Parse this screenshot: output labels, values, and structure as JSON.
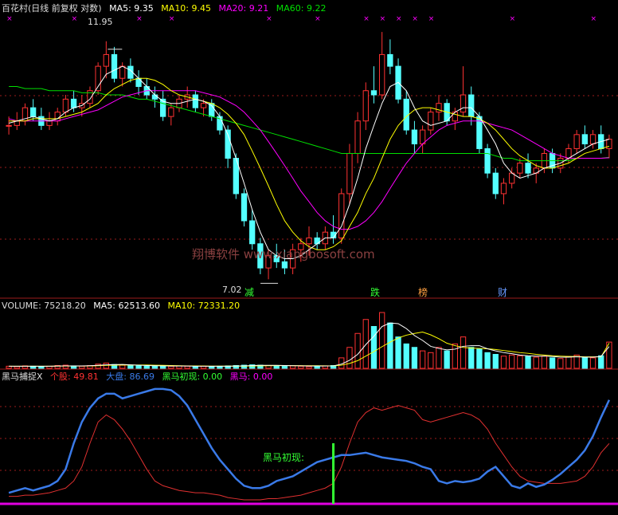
{
  "header_price": {
    "title": "百花村(日线 前复权 对数)",
    "ma5": "MA5: 9.35",
    "ma10": "MA10: 9.45",
    "ma20": "MA20: 9.21",
    "ma60": "MA60: 9.22"
  },
  "header_volume": {
    "title": "VOLUME: 75218.20",
    "ma5": "MA5: 62513.60",
    "ma10": "MA10: 72331.20"
  },
  "header_indicator": {
    "title": "黑马捕捉X",
    "stock": "个股: 49.81",
    "market": "大盘: 86.69",
    "first": "黑马初现: 0.00",
    "horse": "黑马: 0.00"
  },
  "annotations": {
    "high_label": "11.95",
    "low_label": "7.02",
    "watermark": "翔博软件 www.xiangbosoft.com",
    "signal_label": "黑马初现:",
    "tag_reduce": "减",
    "tag_fall": "跌",
    "tag_rank": "榜",
    "tag_finance": "财"
  },
  "colors": {
    "up": "#ff3232",
    "down": "#54ffff",
    "ma5": "#ffffff",
    "ma10": "#ffff00",
    "ma20": "#ff00ff",
    "ma60": "#00e000",
    "stock_line": "#e03030",
    "market_line": "#3a7ae8",
    "signal": "#33ff33",
    "grid": "#9b1b1b"
  },
  "chart_data": [
    {
      "type": "candlestick",
      "title": "百花村(日线 前复权 对数)",
      "price_range": [
        6.9,
        12.6
      ],
      "annotated_high": 11.95,
      "annotated_low": 7.02,
      "ohlc": [
        [
          9.9,
          10.1,
          9.7,
          9.9
        ],
        [
          9.9,
          10.2,
          9.8,
          10.0
        ],
        [
          10.0,
          10.4,
          9.9,
          10.3
        ],
        [
          10.3,
          10.5,
          10.0,
          10.1
        ],
        [
          10.1,
          10.3,
          9.8,
          9.9
        ],
        [
          9.9,
          10.2,
          9.8,
          10.0
        ],
        [
          10.0,
          10.3,
          9.9,
          10.2
        ],
        [
          10.2,
          10.6,
          10.1,
          10.5
        ],
        [
          10.5,
          10.7,
          10.2,
          10.3
        ],
        [
          10.3,
          10.6,
          10.1,
          10.4
        ],
        [
          10.4,
          10.8,
          10.3,
          10.7
        ],
        [
          10.7,
          11.4,
          10.6,
          11.3
        ],
        [
          11.3,
          11.95,
          11.0,
          11.6
        ],
        [
          11.6,
          11.8,
          10.9,
          11.0
        ],
        [
          11.0,
          11.4,
          10.8,
          11.3
        ],
        [
          11.3,
          11.5,
          10.9,
          11.0
        ],
        [
          11.0,
          11.2,
          10.6,
          10.8
        ],
        [
          10.8,
          11.0,
          10.5,
          10.6
        ],
        [
          10.6,
          10.8,
          10.3,
          10.5
        ],
        [
          10.5,
          10.7,
          10.0,
          10.1
        ],
        [
          10.1,
          10.4,
          9.9,
          10.3
        ],
        [
          10.3,
          10.6,
          10.2,
          10.5
        ],
        [
          10.5,
          10.8,
          10.3,
          10.6
        ],
        [
          10.6,
          10.7,
          10.2,
          10.3
        ],
        [
          10.3,
          10.5,
          10.1,
          10.4
        ],
        [
          10.4,
          10.5,
          10.0,
          10.1
        ],
        [
          10.1,
          10.2,
          9.7,
          9.8
        ],
        [
          9.8,
          9.9,
          9.0,
          9.2
        ],
        [
          9.2,
          9.3,
          8.4,
          8.5
        ],
        [
          8.5,
          8.6,
          7.9,
          8.0
        ],
        [
          8.0,
          8.2,
          7.5,
          7.6
        ],
        [
          7.6,
          7.7,
          7.1,
          7.2
        ],
        [
          7.2,
          7.5,
          7.02,
          7.4
        ],
        [
          7.4,
          7.6,
          7.2,
          7.3
        ],
        [
          7.3,
          7.5,
          7.1,
          7.2
        ],
        [
          7.2,
          7.6,
          7.1,
          7.5
        ],
        [
          7.5,
          7.7,
          7.3,
          7.6
        ],
        [
          7.6,
          7.9,
          7.4,
          7.7
        ],
        [
          7.7,
          7.8,
          7.5,
          7.6
        ],
        [
          7.6,
          7.9,
          7.5,
          7.8
        ],
        [
          7.8,
          8.1,
          7.6,
          7.7
        ],
        [
          7.7,
          8.6,
          7.6,
          8.5
        ],
        [
          8.5,
          9.5,
          8.3,
          9.3
        ],
        [
          9.3,
          10.2,
          9.1,
          10.0
        ],
        [
          10.0,
          10.9,
          9.8,
          10.7
        ],
        [
          10.7,
          11.3,
          10.4,
          10.6
        ],
        [
          10.6,
          12.2,
          10.5,
          11.6
        ],
        [
          11.6,
          12.0,
          11.1,
          11.3
        ],
        [
          11.3,
          11.5,
          10.4,
          10.5
        ],
        [
          10.5,
          10.7,
          9.7,
          9.8
        ],
        [
          9.8,
          10.0,
          9.3,
          9.5
        ],
        [
          9.5,
          9.9,
          9.3,
          9.8
        ],
        [
          9.8,
          10.3,
          9.7,
          10.2
        ],
        [
          10.2,
          10.6,
          10.0,
          10.4
        ],
        [
          10.4,
          10.5,
          9.9,
          10.0
        ],
        [
          10.0,
          10.3,
          9.8,
          10.2
        ],
        [
          10.2,
          11.3,
          10.1,
          10.6
        ],
        [
          10.6,
          10.8,
          9.9,
          10.1
        ],
        [
          10.1,
          10.2,
          9.3,
          9.4
        ],
        [
          9.4,
          9.5,
          8.8,
          8.9
        ],
        [
          8.9,
          9.0,
          8.4,
          8.5
        ],
        [
          8.5,
          8.8,
          8.3,
          8.7
        ],
        [
          8.7,
          9.0,
          8.6,
          8.9
        ],
        [
          8.9,
          9.2,
          8.8,
          9.1
        ],
        [
          9.1,
          9.3,
          8.8,
          8.9
        ],
        [
          8.9,
          9.1,
          8.7,
          9.0
        ],
        [
          9.0,
          9.4,
          8.9,
          9.3
        ],
        [
          9.3,
          9.4,
          8.9,
          9.0
        ],
        [
          9.0,
          9.3,
          8.9,
          9.2
        ],
        [
          9.2,
          9.5,
          9.1,
          9.4
        ],
        [
          9.4,
          9.8,
          9.3,
          9.7
        ],
        [
          9.7,
          9.9,
          9.4,
          9.5
        ],
        [
          9.5,
          9.8,
          9.4,
          9.7
        ],
        [
          9.7,
          9.9,
          9.3,
          9.4
        ],
        [
          9.4,
          9.7,
          9.2,
          9.6
        ]
      ],
      "ma5": [
        9.95,
        10.0,
        10.05,
        10.1,
        10.05,
        10.0,
        10.05,
        10.2,
        10.3,
        10.35,
        10.5,
        10.8,
        11.1,
        11.2,
        11.3,
        11.2,
        11.0,
        10.8,
        10.6,
        10.45,
        10.4,
        10.4,
        10.45,
        10.5,
        10.45,
        10.35,
        10.1,
        9.7,
        9.2,
        8.7,
        8.2,
        7.8,
        7.5,
        7.4,
        7.35,
        7.35,
        7.4,
        7.5,
        7.6,
        7.7,
        7.7,
        7.9,
        8.3,
        8.8,
        9.4,
        9.9,
        10.4,
        10.8,
        10.9,
        10.7,
        10.3,
        10.0,
        9.9,
        9.95,
        10.0,
        10.2,
        10.3,
        10.3,
        10.1,
        9.8,
        9.5,
        9.1,
        8.9,
        8.8,
        8.85,
        8.9,
        9.0,
        9.05,
        9.1,
        9.2,
        9.3,
        9.4,
        9.5,
        9.55,
        9.6
      ],
      "ma10": [
        10.0,
        10.0,
        10.0,
        10.05,
        10.05,
        10.05,
        10.05,
        10.1,
        10.15,
        10.2,
        10.3,
        10.4,
        10.6,
        10.75,
        10.85,
        10.95,
        11.0,
        11.0,
        10.95,
        10.85,
        10.7,
        10.6,
        10.55,
        10.5,
        10.45,
        10.4,
        10.3,
        10.15,
        9.95,
        9.7,
        9.35,
        9.0,
        8.65,
        8.3,
        8.0,
        7.8,
        7.65,
        7.55,
        7.5,
        7.5,
        7.55,
        7.65,
        7.9,
        8.15,
        8.5,
        8.8,
        9.2,
        9.6,
        9.9,
        10.1,
        10.25,
        10.3,
        10.3,
        10.25,
        10.2,
        10.15,
        10.1,
        10.1,
        10.05,
        9.95,
        9.8,
        9.6,
        9.4,
        9.25,
        9.15,
        9.05,
        9.0,
        9.0,
        9.05,
        9.1,
        9.2,
        9.3,
        9.35,
        9.4,
        9.45
      ],
      "ma20": [
        10.05,
        10.0,
        10.0,
        10.0,
        10.0,
        10.0,
        10.0,
        10.05,
        10.1,
        10.15,
        10.2,
        10.25,
        10.35,
        10.45,
        10.55,
        10.6,
        10.65,
        10.7,
        10.7,
        10.7,
        10.7,
        10.7,
        10.7,
        10.7,
        10.65,
        10.6,
        10.55,
        10.45,
        10.35,
        10.2,
        10.0,
        9.8,
        9.55,
        9.3,
        9.05,
        8.8,
        8.55,
        8.35,
        8.15,
        8.0,
        7.9,
        7.85,
        7.85,
        7.9,
        8.0,
        8.15,
        8.35,
        8.6,
        8.85,
        9.1,
        9.3,
        9.5,
        9.65,
        9.8,
        9.9,
        9.95,
        10.0,
        10.0,
        10.0,
        9.95,
        9.9,
        9.85,
        9.8,
        9.7,
        9.6,
        9.5,
        9.4,
        9.3,
        9.25,
        9.2,
        9.2,
        9.2,
        9.2,
        9.2,
        9.21
      ],
      "ma60": [
        10.8,
        10.8,
        10.75,
        10.75,
        10.75,
        10.7,
        10.7,
        10.7,
        10.7,
        10.65,
        10.65,
        10.65,
        10.6,
        10.6,
        10.6,
        10.55,
        10.5,
        10.5,
        10.45,
        10.4,
        10.35,
        10.3,
        10.25,
        10.2,
        10.15,
        10.1,
        10.05,
        10.0,
        9.95,
        9.9,
        9.85,
        9.8,
        9.75,
        9.7,
        9.65,
        9.6,
        9.55,
        9.5,
        9.45,
        9.4,
        9.35,
        9.3,
        9.3,
        9.3,
        9.3,
        9.3,
        9.3,
        9.3,
        9.3,
        9.3,
        9.3,
        9.3,
        9.3,
        9.3,
        9.3,
        9.3,
        9.3,
        9.3,
        9.3,
        9.3,
        9.25,
        9.2,
        9.2,
        9.15,
        9.15,
        9.15,
        9.15,
        9.15,
        9.15,
        9.15,
        9.2,
        9.2,
        9.2,
        9.2,
        9.22
      ]
    },
    {
      "type": "bar",
      "title": "VOLUME: 75218.20",
      "ylim": [
        0,
        160000
      ],
      "values": [
        6000,
        5000,
        7000,
        6000,
        5000,
        6000,
        8000,
        9000,
        7000,
        6000,
        8000,
        12000,
        15000,
        11000,
        9000,
        8000,
        7000,
        6000,
        7000,
        6000,
        6000,
        7000,
        6000,
        5000,
        6000,
        5000,
        6000,
        7000,
        8000,
        9000,
        10000,
        9000,
        8000,
        7000,
        6000,
        7000,
        6000,
        5000,
        6000,
        7000,
        8000,
        30000,
        60000,
        100000,
        140000,
        120000,
        160000,
        130000,
        90000,
        70000,
        60000,
        50000,
        45000,
        60000,
        50000,
        70000,
        90000,
        60000,
        55000,
        45000,
        40000,
        35000,
        38000,
        36000,
        34000,
        32000,
        35000,
        30000,
        28000,
        34000,
        38000,
        32000,
        30000,
        36000,
        75218
      ],
      "ma5": [
        6000,
        6000,
        6000,
        6000,
        6000,
        6000,
        6500,
        7000,
        7000,
        7000,
        7500,
        8500,
        10000,
        10500,
        11000,
        10000,
        9000,
        8000,
        7500,
        7000,
        6500,
        6500,
        6500,
        6000,
        6000,
        6000,
        6000,
        6000,
        6500,
        7000,
        8000,
        8500,
        8500,
        8500,
        8000,
        7500,
        7000,
        6500,
        6500,
        6500,
        7000,
        12000,
        23000,
        40000,
        68000,
        92000,
        120000,
        130000,
        128000,
        114000,
        94000,
        80000,
        63000,
        57000,
        53000,
        55000,
        63000,
        65000,
        65000,
        56000,
        50000,
        45000,
        42000,
        38000,
        36000,
        35000,
        35000,
        34000,
        32000,
        32000,
        33000,
        32000,
        32000,
        34000,
        62514
      ],
      "ma10": [
        6000,
        6000,
        6000,
        6000,
        6000,
        6000,
        6200,
        6500,
        6600,
        6600,
        6800,
        7500,
        8500,
        9000,
        9500,
        9500,
        9500,
        9300,
        9000,
        8500,
        8000,
        7500,
        7000,
        6800,
        6600,
        6400,
        6300,
        6200,
        6200,
        6400,
        6800,
        7200,
        7400,
        7600,
        7700,
        7700,
        7600,
        7500,
        7300,
        7100,
        7000,
        9000,
        14000,
        22000,
        35000,
        48000,
        62000,
        75000,
        87000,
        95000,
        100000,
        104000,
        96000,
        85000,
        72000,
        65000,
        60000,
        58000,
        57000,
        56000,
        54000,
        51000,
        48000,
        45000,
        43000,
        40000,
        38000,
        36000,
        35000,
        34000,
        34000,
        33000,
        33000,
        33000,
        72331
      ]
    },
    {
      "type": "line",
      "title": "黑马捕捉X",
      "ylim": [
        0,
        100
      ],
      "series": [
        {
          "name": "个股",
          "values": [
            5,
            5,
            6,
            6,
            7,
            8,
            10,
            12,
            18,
            30,
            50,
            68,
            74,
            70,
            62,
            52,
            40,
            28,
            18,
            14,
            12,
            10,
            9,
            8,
            8,
            7,
            6,
            4,
            3,
            2,
            2,
            2,
            3,
            3,
            4,
            5,
            6,
            8,
            10,
            12,
            16,
            30,
            50,
            68,
            76,
            80,
            78,
            80,
            82,
            80,
            78,
            70,
            68,
            70,
            72,
            74,
            76,
            74,
            70,
            62,
            50,
            40,
            30,
            22,
            18,
            17,
            16,
            16,
            16,
            17,
            18,
            22,
            30,
            42,
            49.81
          ]
        },
        {
          "name": "大盘",
          "values": [
            8,
            10,
            12,
            10,
            12,
            14,
            18,
            28,
            50,
            68,
            80,
            88,
            92,
            92,
            88,
            90,
            92,
            94,
            96,
            96,
            95,
            90,
            82,
            70,
            58,
            46,
            36,
            28,
            20,
            14,
            12,
            12,
            14,
            18,
            20,
            22,
            26,
            30,
            34,
            36,
            38,
            40,
            40,
            41,
            42,
            40,
            38,
            37,
            36,
            35,
            33,
            30,
            28,
            18,
            16,
            18,
            17,
            18,
            20,
            26,
            30,
            22,
            14,
            12,
            16,
            13,
            15,
            19,
            24,
            30,
            36,
            44,
            56,
            72,
            86.69
          ]
        },
        {
          "name": "黑马初现",
          "values": [
            0,
            0,
            0,
            0,
            0,
            0,
            0,
            0,
            0,
            0,
            0,
            0,
            0,
            0,
            0,
            0,
            0,
            0,
            0,
            0,
            0,
            0,
            0,
            0,
            0,
            0,
            0,
            0,
            0,
            0,
            0,
            0,
            0,
            0,
            0,
            0,
            0,
            0,
            0,
            0,
            0,
            0,
            0,
            0,
            0,
            0,
            0,
            0,
            0,
            0,
            0,
            0,
            0,
            0,
            0,
            0,
            0,
            0,
            0,
            0,
            0,
            0,
            0,
            0,
            0,
            0,
            0,
            0,
            0,
            0,
            0,
            0,
            0,
            0,
            0
          ]
        }
      ],
      "signal_index": 40
    }
  ]
}
